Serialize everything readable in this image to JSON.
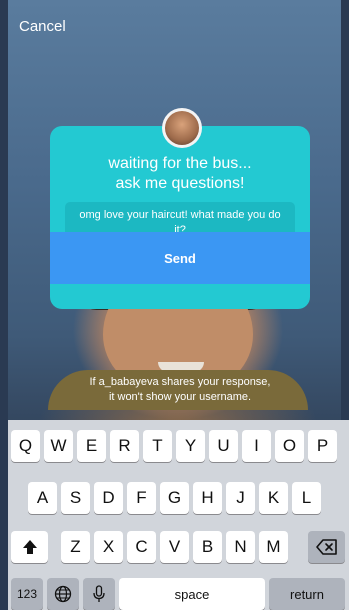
{
  "header": {
    "cancel_label": "Cancel"
  },
  "card": {
    "title_line1": "waiting for the bus...",
    "title_line2": "ask me questions!",
    "reply_text": "omg love your haircut! what made you do it?",
    "send_label": "Send"
  },
  "disclaimer": {
    "line1": "If a_babayeva shares your response,",
    "line2": "it won't show your username."
  },
  "keyboard": {
    "row1": [
      "Q",
      "W",
      "E",
      "R",
      "T",
      "Y",
      "U",
      "I",
      "O",
      "P"
    ],
    "row2": [
      "A",
      "S",
      "D",
      "F",
      "G",
      "H",
      "J",
      "K",
      "L"
    ],
    "row3": [
      "Z",
      "X",
      "C",
      "V",
      "B",
      "N",
      "M"
    ],
    "numbers_label": "123",
    "space_label": "space",
    "return_label": "return"
  },
  "colors": {
    "card_teal": "#23c9d2",
    "send_blue": "#3b97f3",
    "keyboard_bg": "#d1d5db"
  },
  "icons": [
    "globe-icon",
    "microphone-icon",
    "shift-icon",
    "backspace-icon"
  ]
}
